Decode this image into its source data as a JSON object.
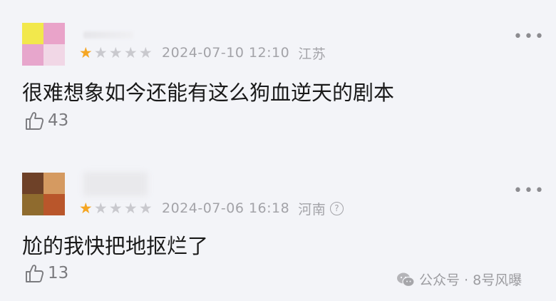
{
  "comments": [
    {
      "avatar_colors": [
        "#f2e84c",
        "#e9a3c9",
        "#e7a6cc",
        "#f1d7e6"
      ],
      "rating": 1,
      "rating_max": 5,
      "date": "2024-07-10 12:10",
      "region": "江苏",
      "text": "很难想象如今还能有这么狗血逆天的剧本",
      "likes": "43"
    },
    {
      "avatar_colors": [
        "#6e4128",
        "#d59a61",
        "#8f6b2e",
        "#b9562b"
      ],
      "rating": 1,
      "rating_max": 5,
      "date": "2024-07-06 16:18",
      "region": "河南",
      "help_glyph": "?",
      "text": "尬的我快把地抠烂了",
      "likes": "13"
    }
  ],
  "more_glyph": "•••",
  "watermark": {
    "text": "公众号 · 8号风曝",
    "icon": "wechat-icon"
  },
  "colors": {
    "background": "#f3f4f8",
    "star_on": "#f5a623",
    "star_off": "#c9c9ce",
    "meta_text": "#a3a3a8"
  }
}
